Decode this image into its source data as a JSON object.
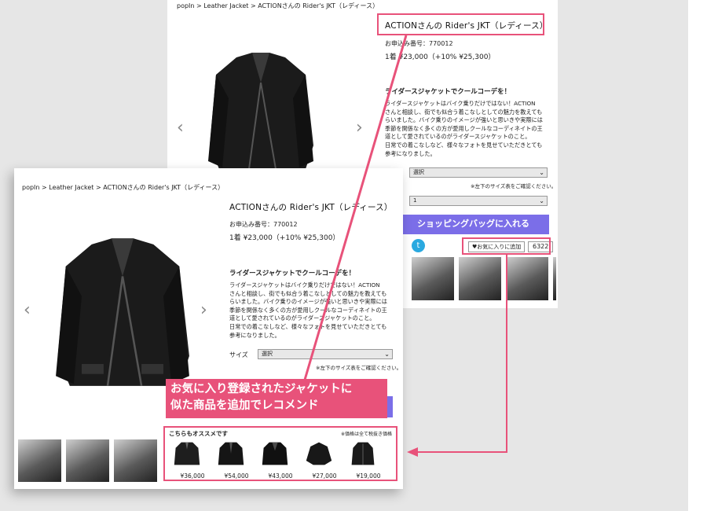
{
  "back": {
    "breadcrumb": "popIn > Leather Jacket > ACTIONさんの Rider's JKT（レディース）",
    "title": "ACTIONさんの Rider's JKT（レディース）",
    "order_no": "お申込み番号：770012",
    "price": "1着  ¥23,000（+10% ¥25,300）",
    "heading": "ライダースジャケットでクールコーデを！",
    "desc": [
      "ライダースジャケットはバイク乗りだけではない！ACTION",
      "さんと相談し、街でも似合う着こなしとしての魅力を教えても",
      "らいました。バイク乗りのイメージが強いと思いきや実際には",
      "季節を関係なく多くの方が愛用しクールなコーディネイトの王",
      "道として愛されているのがライダースジャケットのこと。",
      "日常での着こなしなど、様々なフォトを見せていただきとても",
      "参考になりました。"
    ],
    "size_value": "選択",
    "size_note": "※左下のサイズ表をご確認ください。",
    "qty_value": "1",
    "bag_button": "ショッピングバッグに入れる",
    "fav_button": "♥お気に入りに追加",
    "fav_count": "6322"
  },
  "front": {
    "breadcrumb": "popIn > Leather Jacket > ACTIONさんの Rider's JKT（レディース）",
    "title": "ACTIONさんの Rider's JKT（レディース）",
    "order_no": "お申込み番号：770012",
    "price": "1着  ¥23,000（+10% ¥25,300）",
    "heading": "ライダースジャケットでクールコーデを！",
    "desc": [
      "ライダースジャケットはバイク乗りだけではない！ACTION",
      "さんと相談し、街でも似合う着こなしとしての魅力を教えても",
      "らいました。バイク乗りのイメージが強いと思いきや実際には",
      "季節を関係なく多くの方が愛用しクールなコーディネイトの王",
      "道として愛されているのがライダースジャケットのこと。",
      "日常での着こなしなど、様々なフォトを見せていただきとても",
      "参考になりました。"
    ],
    "size_label": "サイズ",
    "size_value": "選択",
    "size_note": "※左下のサイズ表をご確認ください。"
  },
  "callout": [
    "お気に入り登録されたジャケットに",
    "似た商品を追加でレコメンド"
  ],
  "recommend": {
    "title": "こちらもオススメです",
    "note": "※価格は全て税抜き価格",
    "items": [
      {
        "price": "¥36,000"
      },
      {
        "price": "¥54,000"
      },
      {
        "price": "¥43,000"
      },
      {
        "price": "¥27,000"
      },
      {
        "price": "¥19,000"
      }
    ]
  },
  "arrows": {
    "prev": "‹",
    "next": "›"
  },
  "colors": {
    "accent_pink": "#e8527a",
    "bag_purple": "#7b6ee8",
    "twitter_blue": "#2aa9e0"
  }
}
